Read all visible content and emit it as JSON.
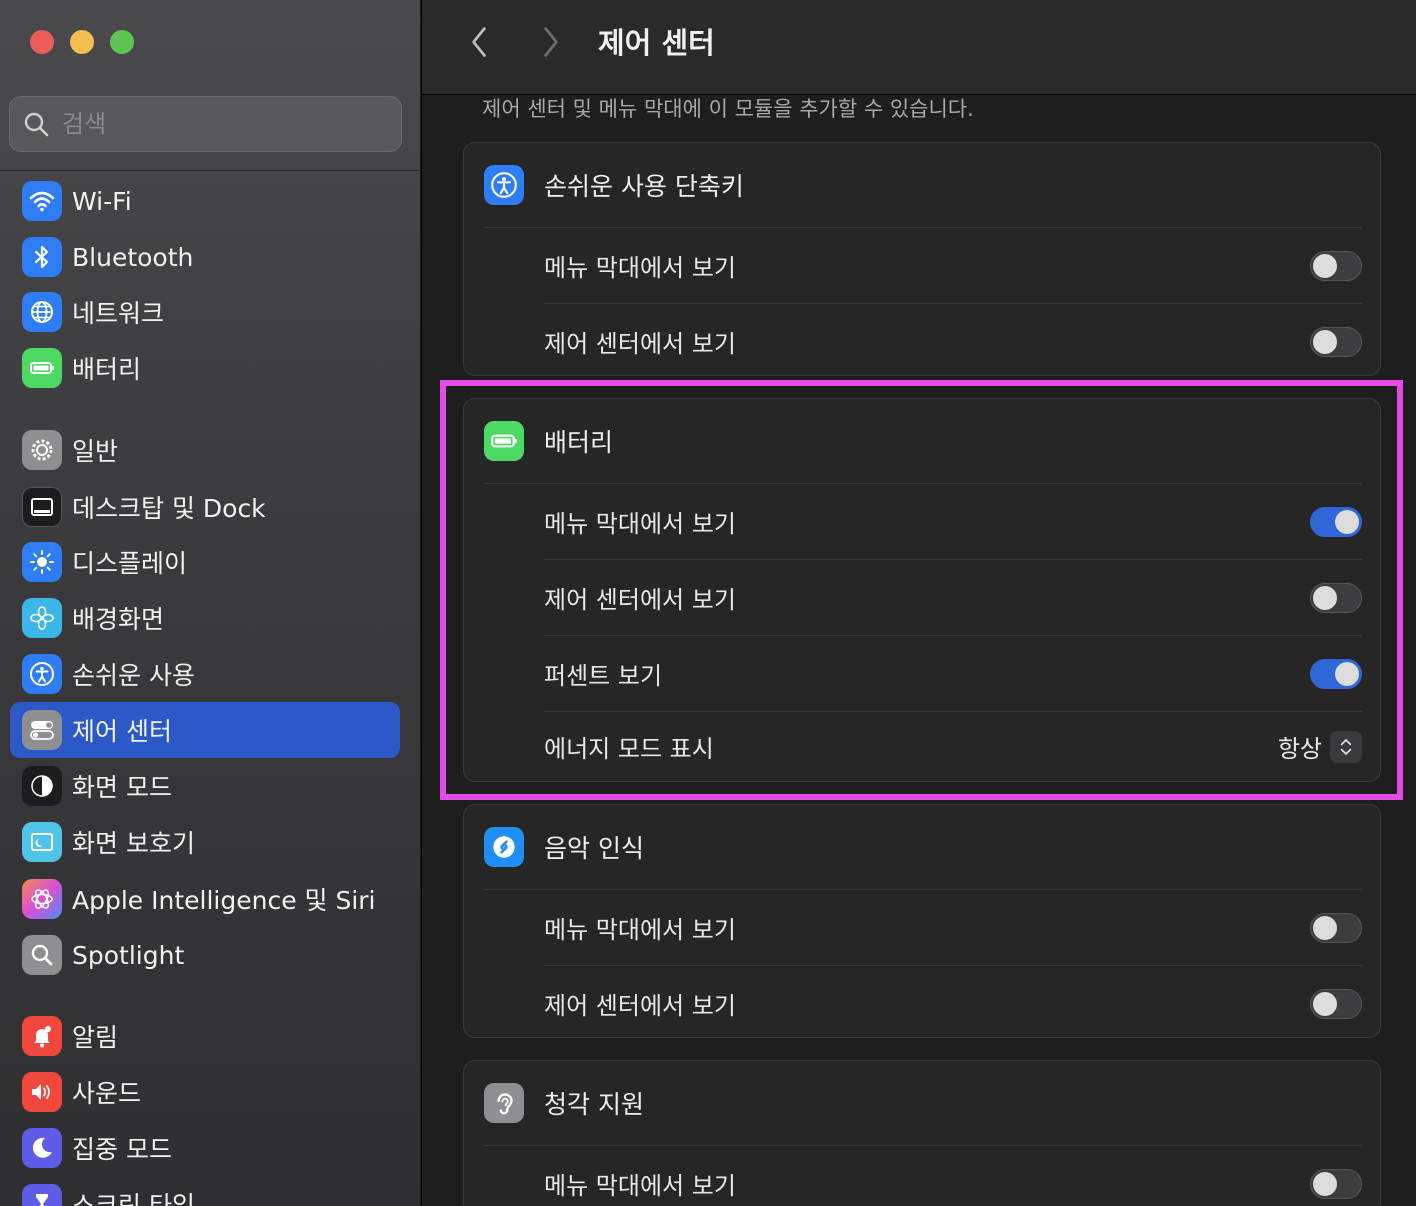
{
  "window": {
    "title": "제어 센터"
  },
  "search": {
    "placeholder": "검색"
  },
  "sidebar": {
    "items": [
      {
        "label": "Wi-Fi",
        "icon": "wifi-icon"
      },
      {
        "label": "Bluetooth",
        "icon": "bluetooth-icon"
      },
      {
        "label": "네트워크",
        "icon": "globe-icon"
      },
      {
        "label": "배터리",
        "icon": "battery-icon"
      },
      {
        "label": "일반",
        "icon": "gear-icon"
      },
      {
        "label": "데스크탑 및 Dock",
        "icon": "dock-icon"
      },
      {
        "label": "디스플레이",
        "icon": "sun-icon"
      },
      {
        "label": "배경화면",
        "icon": "flower-icon"
      },
      {
        "label": "손쉬운 사용",
        "icon": "accessibility-icon"
      },
      {
        "label": "제어 센터",
        "icon": "control-center-icon",
        "active": true
      },
      {
        "label": "화면 모드",
        "icon": "appearance-icon"
      },
      {
        "label": "화면 보호기",
        "icon": "screensaver-icon"
      },
      {
        "label": "Apple Intelligence 및 Siri",
        "icon": "siri-icon"
      },
      {
        "label": "Spotlight",
        "icon": "spotlight-icon"
      },
      {
        "label": "알림",
        "icon": "bell-icon"
      },
      {
        "label": "사운드",
        "icon": "speaker-icon"
      },
      {
        "label": "집중 모드",
        "icon": "moon-icon"
      },
      {
        "label": "스크린 타임",
        "icon": "hourglass-icon"
      }
    ]
  },
  "main": {
    "subtitle": "제어 센터 및 메뉴 막대에 이 모듈을 추가할 수 있습니다.",
    "cards": [
      {
        "title": "손쉬운 사용 단축키",
        "icon": "accessibility-icon",
        "rows": [
          {
            "label": "메뉴 막대에서 보기",
            "on": false
          },
          {
            "label": "제어 센터에서 보기",
            "on": false
          }
        ]
      },
      {
        "title": "배터리",
        "icon": "battery-icon",
        "rows": [
          {
            "label": "메뉴 막대에서 보기",
            "on": true
          },
          {
            "label": "제어 센터에서 보기",
            "on": false
          },
          {
            "label": "퍼센트 보기",
            "on": true
          },
          {
            "label": "에너지 모드 표시",
            "select": "항상"
          }
        ]
      },
      {
        "title": "음악 인식",
        "icon": "shazam-icon",
        "rows": [
          {
            "label": "메뉴 막대에서 보기",
            "on": false
          },
          {
            "label": "제어 센터에서 보기",
            "on": false
          }
        ]
      },
      {
        "title": "청각 지원",
        "icon": "ear-icon",
        "rows": [
          {
            "label": "메뉴 막대에서 보기",
            "on": false
          }
        ]
      }
    ]
  },
  "colors": {
    "accent": "#2c59c7",
    "toggle_on": "#2f66d8",
    "highlight": "#e34be8"
  }
}
